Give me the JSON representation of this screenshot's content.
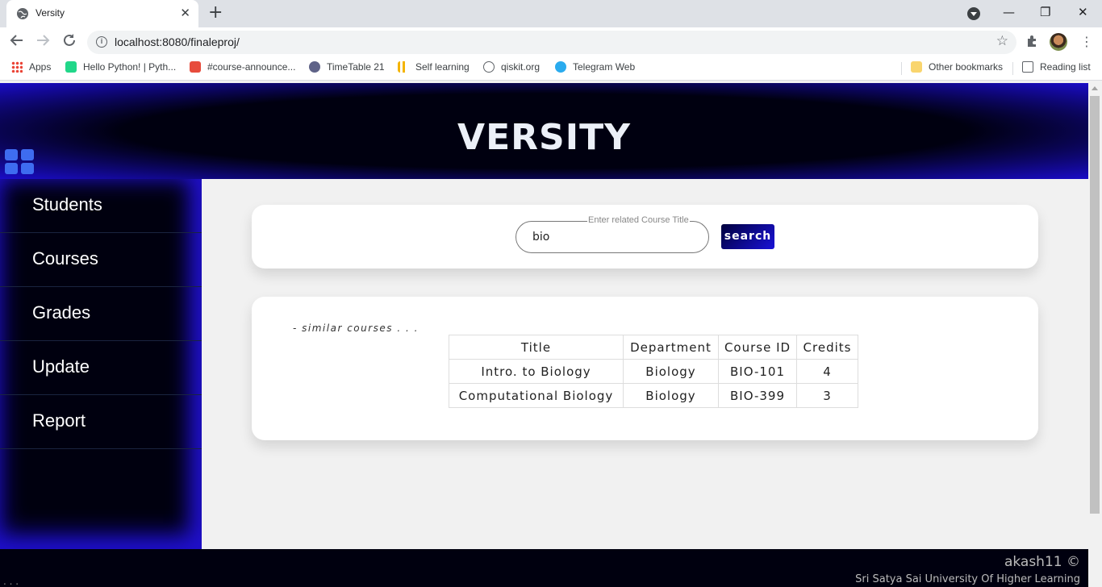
{
  "browser": {
    "tab_title": "Versity",
    "tab_close": "✕",
    "new_tab": "+",
    "url": "localhost:8080/finaleproj/",
    "info": "i",
    "star": "☆",
    "kebab": "⋮",
    "window_controls": {
      "minimize": "—",
      "restore": "❐",
      "close": "✕"
    },
    "bookmarks": [
      {
        "label": "Apps",
        "icon": "apps-grid-icon",
        "color": "#ea4335"
      },
      {
        "label": "Hello Python! | Pyth...",
        "icon": "pycharm-icon",
        "color": "#21d789"
      },
      {
        "label": "#course-announce...",
        "icon": "course-icon",
        "color": "#e74c3c"
      },
      {
        "label": "TimeTable 21",
        "icon": "timetable-icon",
        "color": "#5f6388"
      },
      {
        "label": "Self learning",
        "icon": "bar-chart-icon",
        "color": "#f4b400"
      },
      {
        "label": "qiskit.org",
        "icon": "globe-icon",
        "color": "#5f6368"
      },
      {
        "label": "Telegram Web",
        "icon": "telegram-icon",
        "color": "#2aabee"
      }
    ],
    "other_bookmarks": "Other bookmarks",
    "reading_list": "Reading list"
  },
  "header": {
    "title": "VERSITY",
    "accent_color": "#2a10ff"
  },
  "sidebar": {
    "items": [
      {
        "label": "Students"
      },
      {
        "label": "Courses"
      },
      {
        "label": "Grades"
      },
      {
        "label": "Update"
      },
      {
        "label": "Report"
      }
    ]
  },
  "search": {
    "legend": "Enter related Course Title",
    "value": "bio",
    "button_label": "search"
  },
  "results": {
    "note": "- similar courses . . .",
    "columns": [
      "Title",
      "Department",
      "Course ID",
      "Credits"
    ],
    "rows": [
      [
        "Intro. to Biology",
        "Biology",
        "BIO-101",
        "4"
      ],
      [
        "Computational Biology",
        "Biology",
        "BIO-399",
        "3"
      ]
    ]
  },
  "footer": {
    "author": "akash11 ©",
    "university": "Sri Satya Sai University Of Higher Learning",
    "dots": ". . ."
  }
}
